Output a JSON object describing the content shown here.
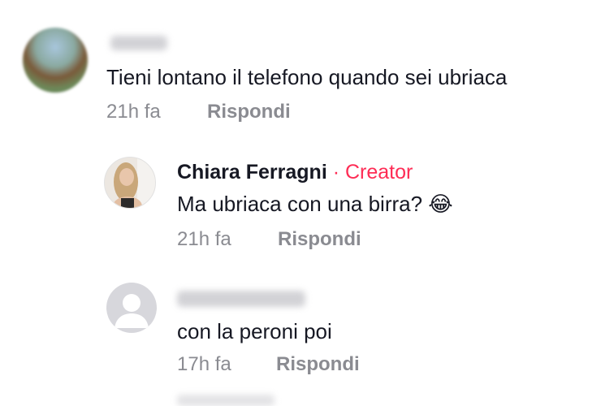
{
  "comments": [
    {
      "text": "Tieni lontano il telefono quando sei ubriaca",
      "time": "21h fa",
      "reply_label": "Rispondi"
    },
    {
      "author": "Chiara Ferragni",
      "separator": " · ",
      "badge": "Creator",
      "text": "Ma ubriaca con una birra? 😂",
      "time": "21h fa",
      "reply_label": "Rispondi"
    },
    {
      "text": "con la peroni poi",
      "time": "17h fa",
      "reply_label": "Rispondi"
    }
  ],
  "colors": {
    "creator_accent": "#fe2c55",
    "meta_gray": "#8a8b91",
    "text": "#161823"
  }
}
